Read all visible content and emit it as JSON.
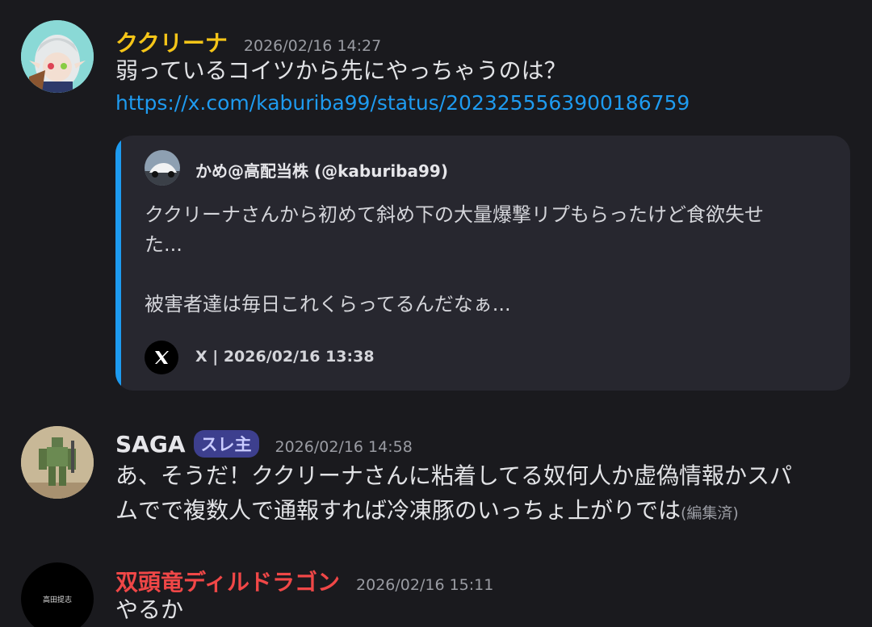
{
  "messages": [
    {
      "username": "ククリーナ",
      "username_color": "#f5c518",
      "timestamp": "2026/02/16 14:27",
      "text": "弱っているコイツから先にやっちゃうのは？",
      "link": "https://x.com/kaburiba99/status/2023255563900186759",
      "embed": {
        "author": "かめ@高配当株 (@kaburiba99)",
        "description_line1": "ククリーナさんから初めて斜め下の大量爆撃リプもらったけど食欲失せ",
        "description_line2": "た...",
        "description_line3": "被害者達は毎日これくらってるんだなぁ...",
        "footer": "X | 2026/02/16 13:38",
        "accent_color": "#1d9bf0"
      }
    },
    {
      "username": "SAGA",
      "username_color": "#e6e6ea",
      "badge": "スレ主",
      "timestamp": "2026/02/16 14:58",
      "text_line1": "あ、そうだ！ククリーナさんに粘着してる奴何人か虚偽情報かスパ",
      "text_line2": "ムでで複数人で通報すれば冷凍豚のいっちょ上がりでは",
      "edited": "(編集済)"
    },
    {
      "username": "双頭竜ディルドラゴン",
      "username_color": "#f04747",
      "timestamp": "2026/02/16 15:11",
      "text": "やるか",
      "avatar_text": "高田提志"
    }
  ]
}
